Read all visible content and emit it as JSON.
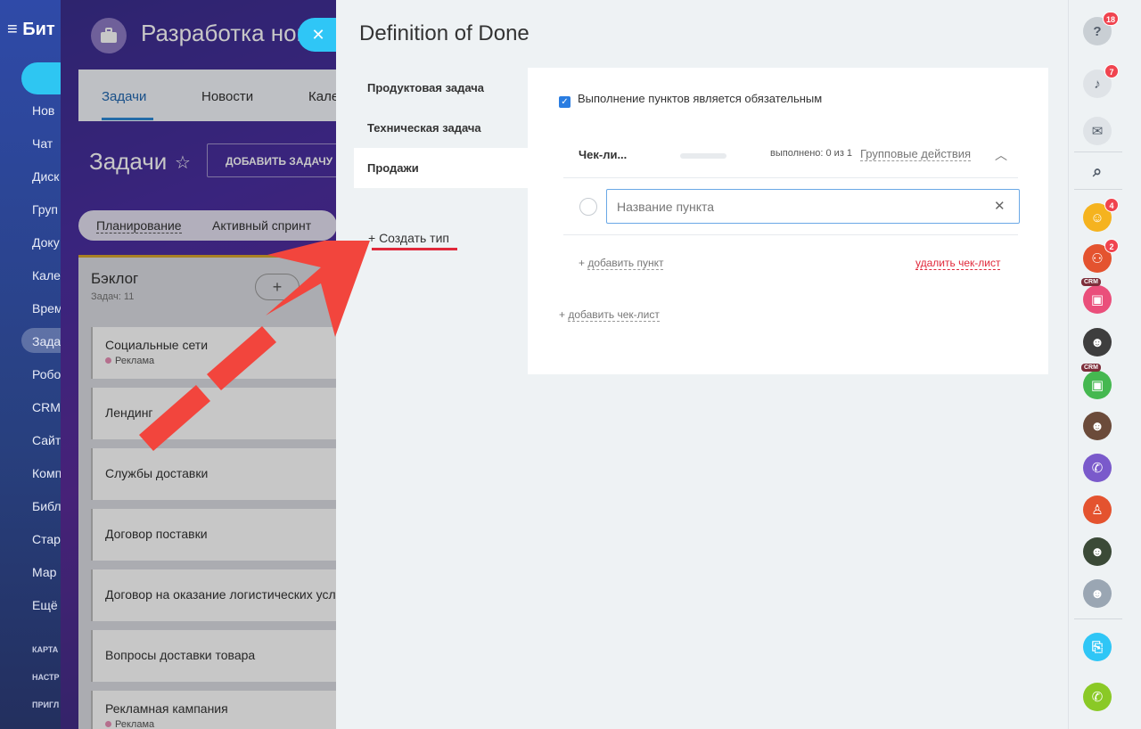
{
  "left_nav": {
    "brand": "Бит",
    "items": [
      "Нов",
      "Чат",
      "Диск",
      "Груп",
      "Доку",
      "Кале",
      "Врем",
      "Зада",
      "Робо",
      "CRM",
      "Сайт",
      "Комп",
      "Библ",
      "Стар",
      "Мар",
      "Ещё"
    ],
    "small_items": [
      "КАРТА",
      "НАСТР",
      "ПРИГЛ"
    ]
  },
  "project": {
    "title": "Разработка нов",
    "tabs": [
      "Задачи",
      "Новости",
      "Кале"
    ],
    "tasks_title": "Задачи",
    "add_task_label": "ДОБАВИТЬ ЗАДАЧУ",
    "views": [
      "Планирование",
      "Активный спринт"
    ],
    "backlog": {
      "title": "Бэклог",
      "count": "Задач: 11",
      "cards": [
        {
          "title": "Социальные сети",
          "tag": "Реклама"
        },
        {
          "title": "Лендинг",
          "tag": ""
        },
        {
          "title": "Службы доставки",
          "tag": ""
        },
        {
          "title": "Договор поставки",
          "tag": ""
        },
        {
          "title": "Договор на оказание логистических усл",
          "tag": ""
        },
        {
          "title": "Вопросы доставки товара",
          "tag": ""
        },
        {
          "title": "Рекламная кампания",
          "tag": "Реклама"
        }
      ]
    }
  },
  "slider": {
    "title": "Definition of Done",
    "types": [
      "Продуктовая задача",
      "Техническая задача",
      "Продажи"
    ],
    "active_type": "Продажи",
    "create_type_label": "+ Создать тип",
    "mandatory_label": "Выполнение пунктов является обязательным",
    "checklist": {
      "name": "Чек-ли...",
      "progress_text": "выполнено: 0 из 1",
      "progress_value": 0,
      "group_actions": "Групповые действия",
      "item_placeholder": "Название пункта",
      "add_item": "добавить пункт",
      "delete_checklist": "удалить чек-лист",
      "add_checklist": "добавить чек-лист"
    }
  },
  "right_rail": {
    "help_badge": "18",
    "notifications_badge": "7",
    "avatar_badge_1": "4",
    "avatar_badge_2": "2",
    "crm_label": "CRM"
  },
  "colors": {
    "accent_blue": "#2a7de1",
    "danger_red": "#e0283a",
    "arrow_red": "#f2453d",
    "close_button": "#2fc6f6"
  }
}
